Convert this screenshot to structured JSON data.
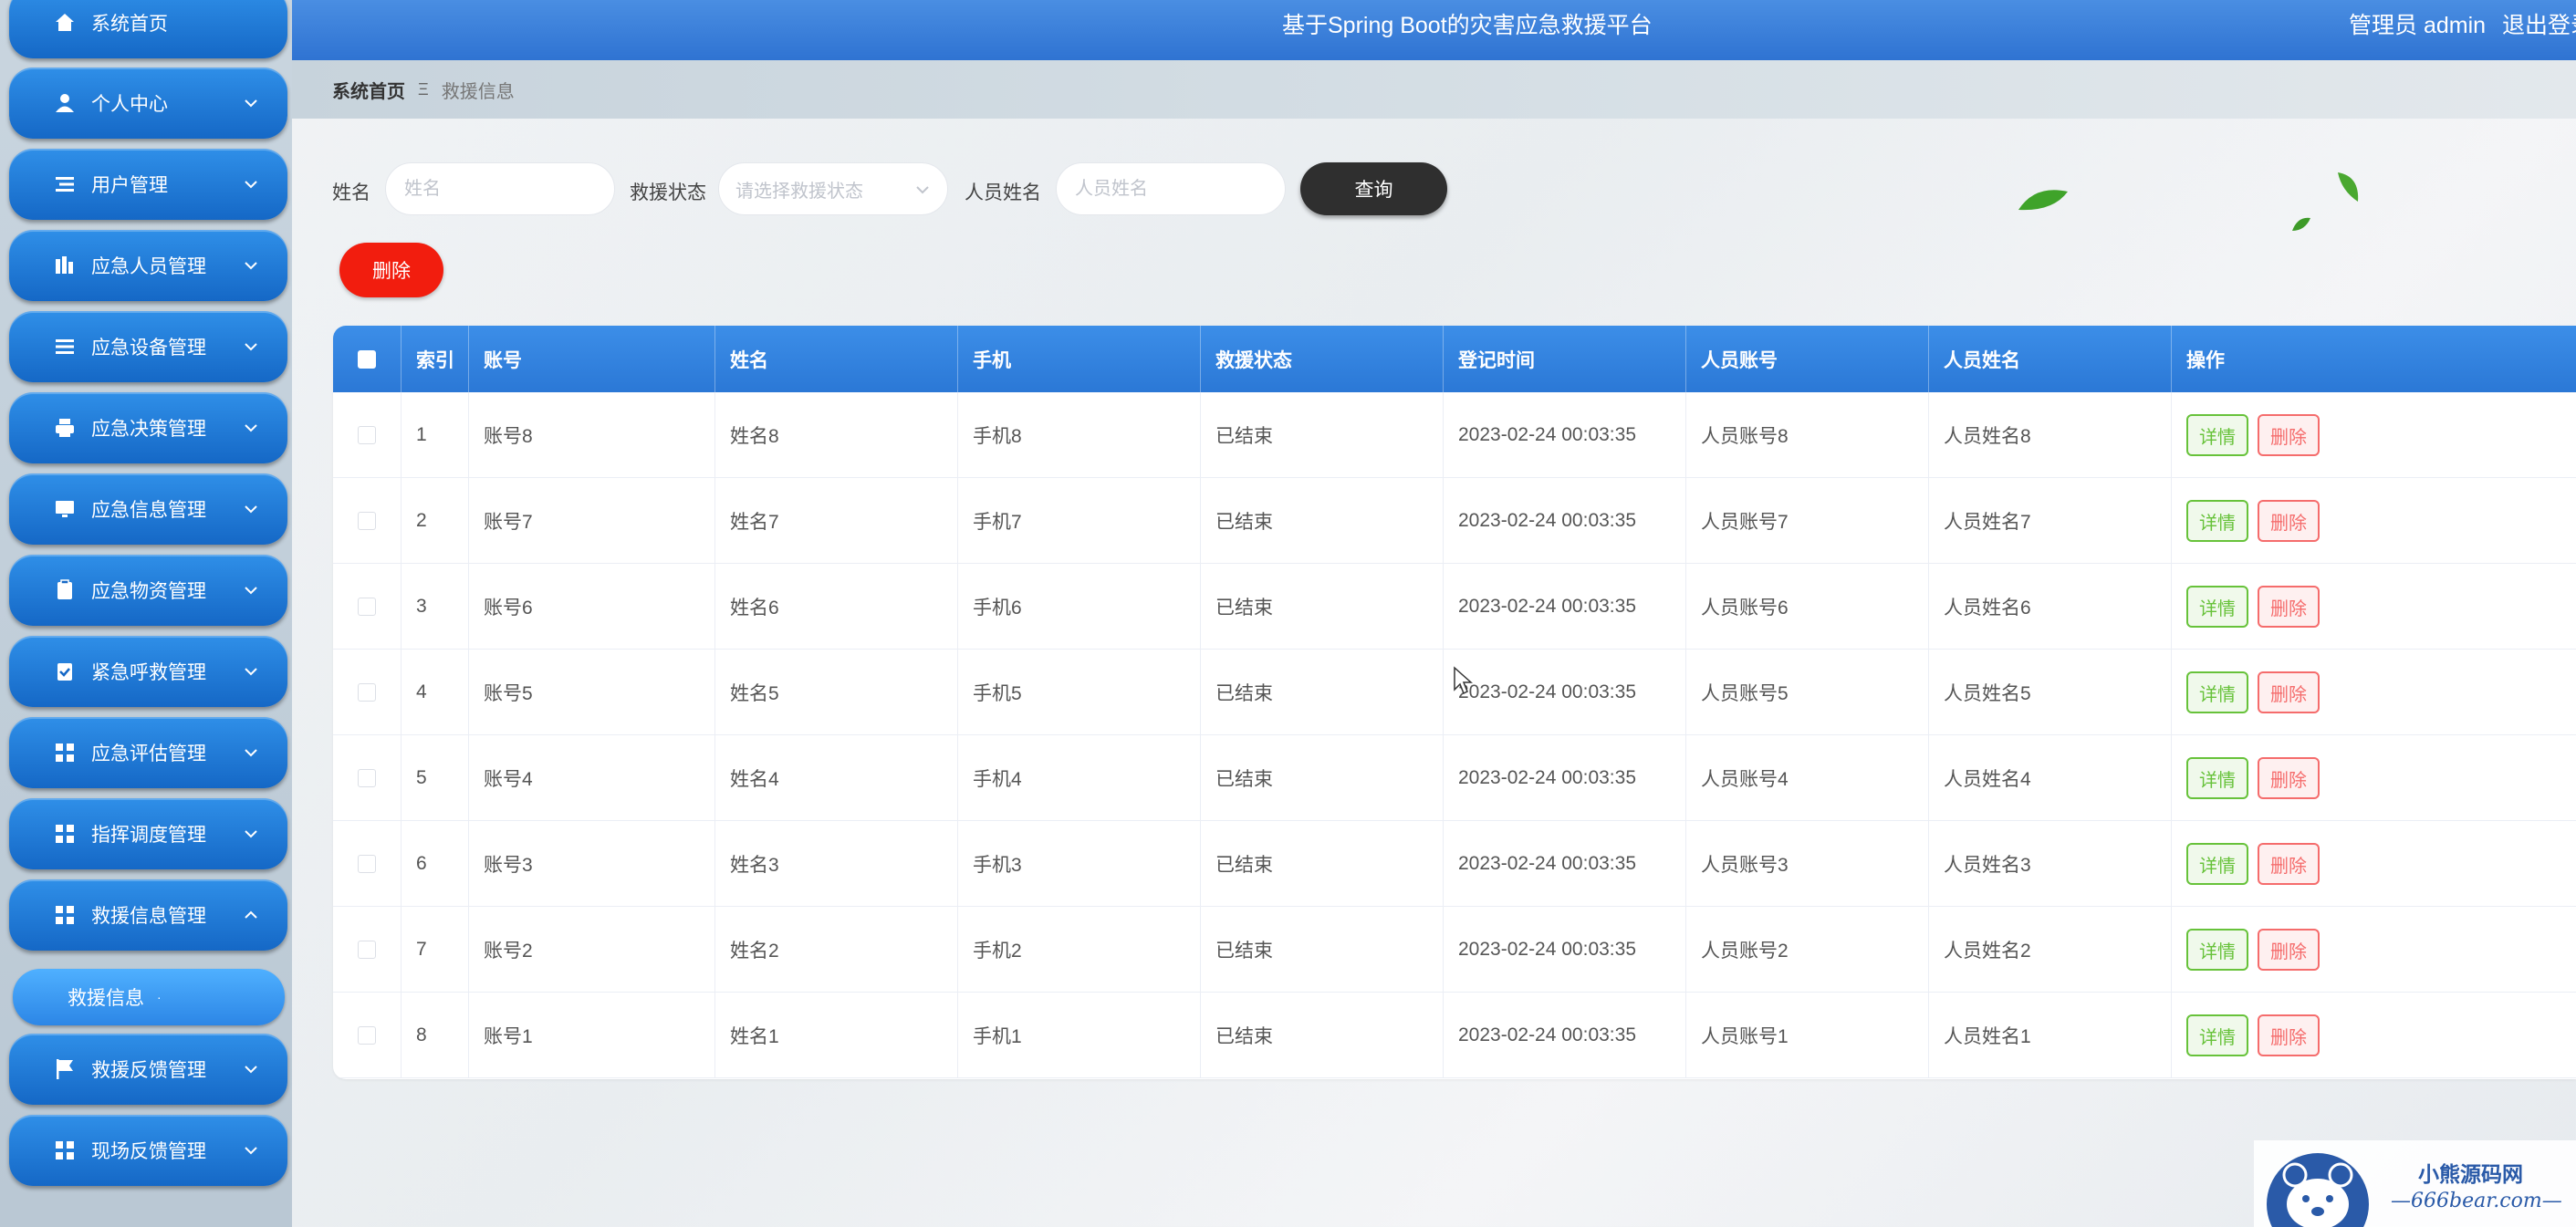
{
  "header": {
    "title": "基于Spring Boot的灾害应急救援平台",
    "user": "管理员 admin",
    "logout": "退出登录"
  },
  "sidebar": {
    "items": [
      {
        "label": "系统首页",
        "icon": "home-icon",
        "has_chevron": false
      },
      {
        "label": "个人中心",
        "icon": "user-icon",
        "has_chevron": true
      },
      {
        "label": "用户管理",
        "icon": "list-icon",
        "has_chevron": true
      },
      {
        "label": "应急人员管理",
        "icon": "chart-icon",
        "has_chevron": true
      },
      {
        "label": "应急设备管理",
        "icon": "menu-icon",
        "has_chevron": true
      },
      {
        "label": "应急决策管理",
        "icon": "printer-icon",
        "has_chevron": true
      },
      {
        "label": "应急信息管理",
        "icon": "monitor-icon",
        "has_chevron": true
      },
      {
        "label": "应急物资管理",
        "icon": "clipboard-icon",
        "has_chevron": true
      },
      {
        "label": "紧急呼救管理",
        "icon": "clipboard-check-icon",
        "has_chevron": true
      },
      {
        "label": "应急评估管理",
        "icon": "grid-icon",
        "has_chevron": true
      },
      {
        "label": "指挥调度管理",
        "icon": "grid-icon",
        "has_chevron": true
      },
      {
        "label": "救援信息管理",
        "icon": "grid-icon",
        "has_chevron": true,
        "expanded": true
      },
      {
        "label": "救援反馈管理",
        "icon": "flag-icon",
        "has_chevron": true
      },
      {
        "label": "现场反馈管理",
        "icon": "grid-icon",
        "has_chevron": true
      }
    ],
    "active_submenu": "救援信息"
  },
  "breadcrumb": {
    "home": "系统首页",
    "separator": "Ξ",
    "current": "救援信息"
  },
  "search": {
    "name_label": "姓名",
    "name_placeholder": "姓名",
    "status_label": "救援状态",
    "status_placeholder": "请选择救援状态",
    "staff_label": "人员姓名",
    "staff_placeholder": "人员姓名",
    "query_button": "查询"
  },
  "actions": {
    "delete_button": "删除"
  },
  "table": {
    "columns": [
      "索引",
      "账号",
      "姓名",
      "手机",
      "救援状态",
      "登记时间",
      "人员账号",
      "人员姓名",
      "操作"
    ],
    "rows": [
      {
        "index": "1",
        "account": "账号8",
        "name": "姓名8",
        "phone": "手机8",
        "status": "已结束",
        "time": "2023-02-24 00:03:35",
        "staff_account": "人员账号8",
        "staff_name": "人员姓名8"
      },
      {
        "index": "2",
        "account": "账号7",
        "name": "姓名7",
        "phone": "手机7",
        "status": "已结束",
        "time": "2023-02-24 00:03:35",
        "staff_account": "人员账号7",
        "staff_name": "人员姓名7"
      },
      {
        "index": "3",
        "account": "账号6",
        "name": "姓名6",
        "phone": "手机6",
        "status": "已结束",
        "time": "2023-02-24 00:03:35",
        "staff_account": "人员账号6",
        "staff_name": "人员姓名6"
      },
      {
        "index": "4",
        "account": "账号5",
        "name": "姓名5",
        "phone": "手机5",
        "status": "已结束",
        "time": "2023-02-24 00:03:35",
        "staff_account": "人员账号5",
        "staff_name": "人员姓名5"
      },
      {
        "index": "5",
        "account": "账号4",
        "name": "姓名4",
        "phone": "手机4",
        "status": "已结束",
        "time": "2023-02-24 00:03:35",
        "staff_account": "人员账号4",
        "staff_name": "人员姓名4"
      },
      {
        "index": "6",
        "account": "账号3",
        "name": "姓名3",
        "phone": "手机3",
        "status": "已结束",
        "time": "2023-02-24 00:03:35",
        "staff_account": "人员账号3",
        "staff_name": "人员姓名3"
      },
      {
        "index": "7",
        "account": "账号2",
        "name": "姓名2",
        "phone": "手机2",
        "status": "已结束",
        "time": "2023-02-24 00:03:35",
        "staff_account": "人员账号2",
        "staff_name": "人员姓名2"
      },
      {
        "index": "8",
        "account": "账号1",
        "name": "姓名1",
        "phone": "手机1",
        "status": "已结束",
        "time": "2023-02-24 00:03:35",
        "staff_account": "人员账号1",
        "staff_name": "人员姓名1"
      }
    ],
    "detail_label": "详情",
    "delete_label": "删除"
  },
  "watermark": {
    "title": "小熊源码网",
    "site": "—666bear.com—"
  },
  "colors": {
    "header_blue": "#2f73d2",
    "sidebar_blue": "#1568c6",
    "query_button": "#2f2f2f",
    "delete_red": "#f21d0e",
    "detail_green": "#67c23a",
    "row_delete_red": "#f56c6c"
  }
}
